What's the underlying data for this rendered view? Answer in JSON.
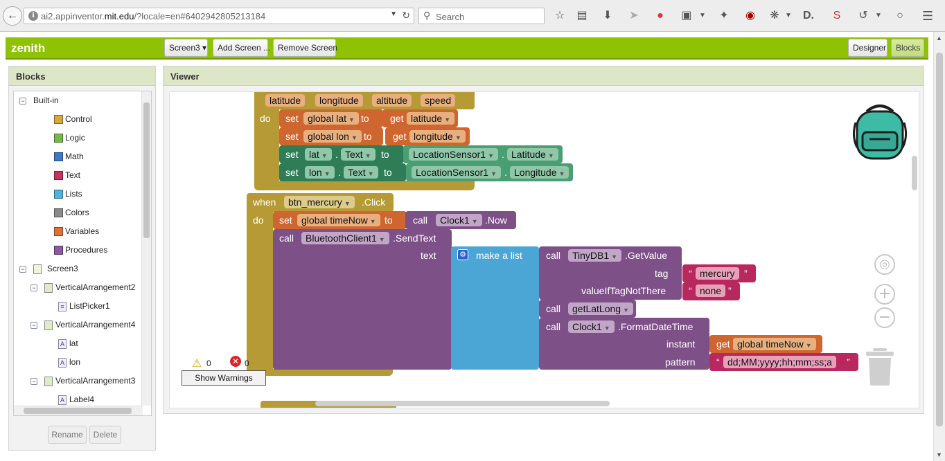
{
  "browser": {
    "url_prefix": "ai2.appinventor.",
    "url_domain": "mit.edu",
    "url_suffix": "/?locale=en#6402942805213184",
    "search_placeholder": "Search",
    "back_icon": "back-arrow-icon",
    "reload_icon": "reload-icon"
  },
  "header": {
    "project_name": "zenith",
    "screen_select": "Screen3 ▾",
    "add_screen": "Add Screen ...",
    "remove_screen": "Remove Screen",
    "designer": "Designer",
    "blocks": "Blocks",
    "bar_color": "#8fc202"
  },
  "blocks_panel": {
    "title": "Blocks",
    "builtin_label": "Built-in",
    "builtin": [
      {
        "label": "Control",
        "color": "#d8a83a"
      },
      {
        "label": "Logic",
        "color": "#76b84b"
      },
      {
        "label": "Math",
        "color": "#3f79c8"
      },
      {
        "label": "Text",
        "color": "#c7325f"
      },
      {
        "label": "Lists",
        "color": "#4cb4de"
      },
      {
        "label": "Colors",
        "color": "#8a8a8a"
      },
      {
        "label": "Variables",
        "color": "#e0703a"
      },
      {
        "label": "Procedures",
        "color": "#8d5aa0"
      }
    ],
    "components": {
      "screen": "Screen3",
      "va2": "VerticalArrangement2",
      "listpicker": "ListPicker1",
      "va4": "VerticalArrangement4",
      "lat": "lat",
      "lon": "lon",
      "va3": "VerticalArrangement3",
      "label4": "Label4"
    },
    "rename": "Rename",
    "delete": "Delete"
  },
  "viewer": {
    "title": "Viewer",
    "warnings_count": "0",
    "errors_count": "0",
    "show_warnings": "Show Warnings"
  },
  "blocks": {
    "event1": {
      "params": [
        "latitude",
        "longitude",
        "altitude",
        "speed"
      ],
      "do": "do",
      "set": "set",
      "to": "to",
      "get": "get",
      "global_lat": "global lat",
      "global_lon": "global lon",
      "get_latitude": "latitude",
      "get_longitude": "longitude",
      "lat": "lat",
      "lon": "lon",
      "dot": ".",
      "text_prop": "Text",
      "sensor": "LocationSensor1",
      "latitude_prop": "Latitude",
      "longitude_prop": "Longitude"
    },
    "event2": {
      "when": "when",
      "component": "btn_mercury",
      "event": ".Click",
      "do": "do",
      "set": "set",
      "global_timenow": "global timeNow",
      "to": "to",
      "call": "call",
      "clock": "Clock1",
      "now": ".Now",
      "bt": "BluetoothClient1",
      "sendtext": ".SendText",
      "text_arg": "text",
      "make_list": "make a list",
      "tinydb": "TinyDB1",
      "getvalue": ".GetValue",
      "tag": "tag",
      "mercury": "mercury",
      "value_if": "valueIfTagNotThere",
      "none": "none",
      "getlatlong": "getLatLong",
      "formatdatetime": ".FormatDateTime",
      "instant": "instant",
      "get": "get",
      "pattern": "pattern",
      "pattern_value": "dd;MM;yyyy;hh;mm;ss;a",
      "open_quote": "“",
      "close_quote": "”"
    }
  }
}
